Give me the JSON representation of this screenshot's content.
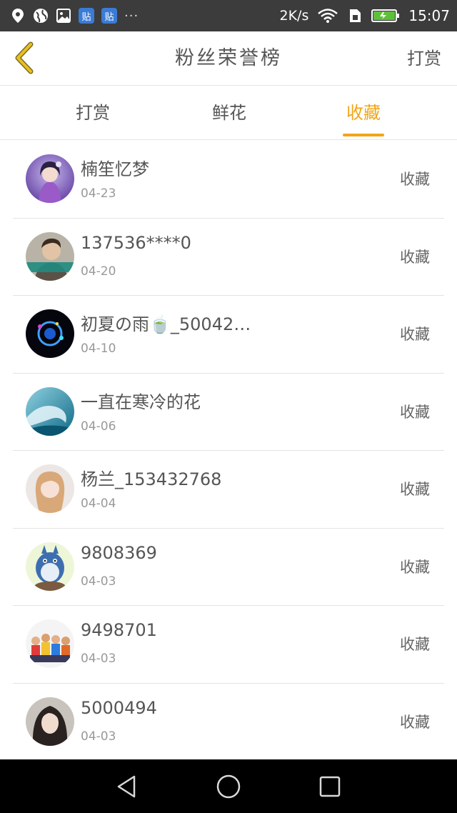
{
  "status_bar": {
    "speed": "2K/s",
    "time": "15:07",
    "badges": [
      "贴",
      "贴"
    ],
    "more": "···",
    "icons": [
      "location-icon",
      "globe-icon",
      "image-icon",
      "wifi-icon",
      "sim-icon",
      "battery-icon"
    ]
  },
  "header": {
    "title": "粉丝荣誉榜",
    "action": "打赏"
  },
  "tabs": [
    {
      "label": "打赏",
      "active": false
    },
    {
      "label": "鲜花",
      "active": false
    },
    {
      "label": "收藏",
      "active": true
    }
  ],
  "colors": {
    "accent": "#f2a516",
    "statusbar": "#3c3c3c",
    "navbar": "#000000"
  },
  "fans": [
    {
      "name": "楠笙忆梦",
      "date": "04-23",
      "action": "收藏"
    },
    {
      "name": "137536****0",
      "date": "04-20",
      "action": "收藏"
    },
    {
      "name": "初夏の雨🍵_50042…",
      "date": "04-10",
      "action": "收藏"
    },
    {
      "name": "一直在寒冷的花",
      "date": "04-06",
      "action": "收藏"
    },
    {
      "name": "杨兰_153432768",
      "date": "04-04",
      "action": "收藏"
    },
    {
      "name": "9808369",
      "date": "04-03",
      "action": "收藏"
    },
    {
      "name": "9498701",
      "date": "04-03",
      "action": "收藏"
    },
    {
      "name": "5000494",
      "date": "04-03",
      "action": "收藏"
    }
  ]
}
